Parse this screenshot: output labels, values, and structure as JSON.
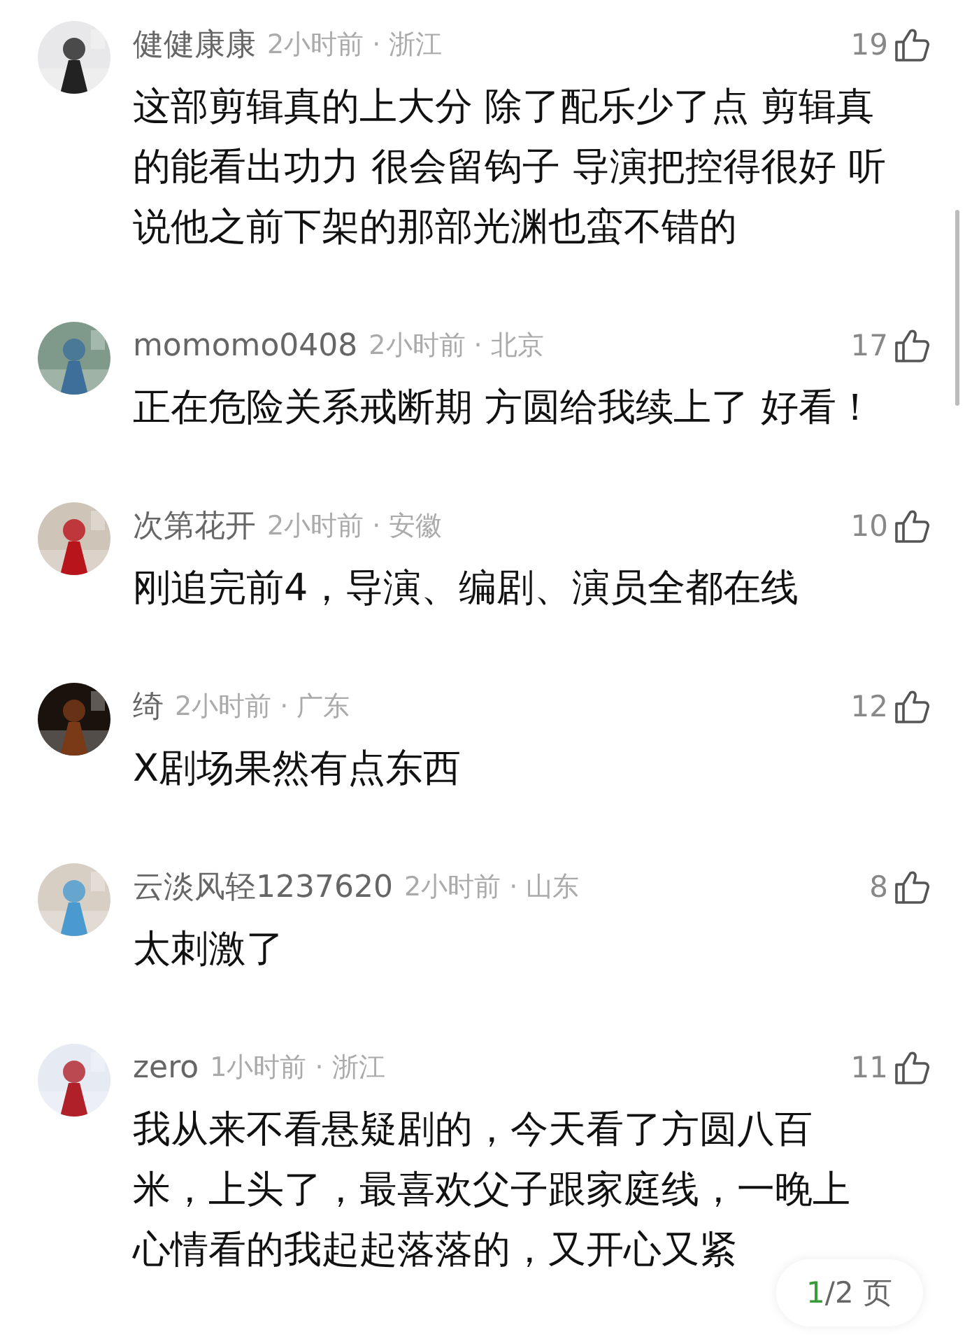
{
  "comments": [
    {
      "user": "健健康康",
      "meta": "2小时前 · 浙江",
      "likes": "19",
      "lines": [
        "这部剪辑真的上大分 除了配乐少了点 剪辑真",
        "的能看出功力 很会留钩子 导演把控得很好 听",
        "说他之前下架的那部光渊也蛮不错的"
      ]
    },
    {
      "user": "momomo0408",
      "meta": "2小时前 · 北京",
      "likes": "17",
      "lines": [
        "正在危险关系戒断期 方圆给我续上了 好看！"
      ]
    },
    {
      "user": "次第花开",
      "meta": "2小时前 · 安徽",
      "likes": "10",
      "lines": [
        "刚追完前4，导演、编剧、演员全都在线"
      ]
    },
    {
      "user": "绮",
      "meta": "2小时前 · 广东",
      "likes": "12",
      "lines": [
        "X剧场果然有点东西"
      ]
    },
    {
      "user": "云淡风轻1237620",
      "meta": "2小时前 · 山东",
      "likes": "8",
      "lines": [
        "太刺激了"
      ]
    },
    {
      "user": "zero",
      "meta": "1小时前 · 浙江",
      "likes": "11",
      "lines": [
        "我从来不看悬疑剧的，今天看了方圆八百",
        "米，上头了，最喜欢父子跟家庭线，一晚上",
        "心情看的我起起落落的，又开心又紧"
      ]
    }
  ],
  "pager": {
    "current": "1",
    "total": "/2",
    "unit": "页"
  }
}
